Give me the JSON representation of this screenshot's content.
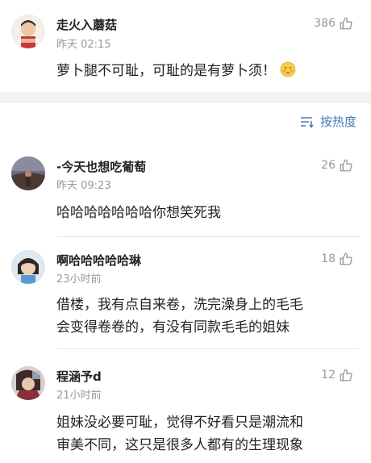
{
  "comments": [
    {
      "username": "走火入蘑菇",
      "time": "昨天 02:15",
      "likes": "386",
      "text": "萝卜腿不可耻，可耻的是有萝卜须！"
    },
    {
      "username": "-今天也想吃葡萄",
      "time": "昨天 09:23",
      "likes": "26",
      "text": "哈哈哈哈哈哈哈你想笑死我"
    },
    {
      "username": "啊哈哈哈哈哈琳",
      "time": "23小时前",
      "likes": "18",
      "text_line1": "借楼，我有点自来卷，洗完澡身上的毛毛",
      "text_line2": "会变得卷卷的，有没有同款毛毛的姐妹"
    },
    {
      "username": "程涵予d",
      "time": "21小时前",
      "likes": "12",
      "text_line1": "姐妹没必要可耻，觉得不好看只是潮流和",
      "text_line2": "审美不同，这只是很多人都有的生理现象"
    }
  ],
  "sort": {
    "label": "按热度"
  }
}
